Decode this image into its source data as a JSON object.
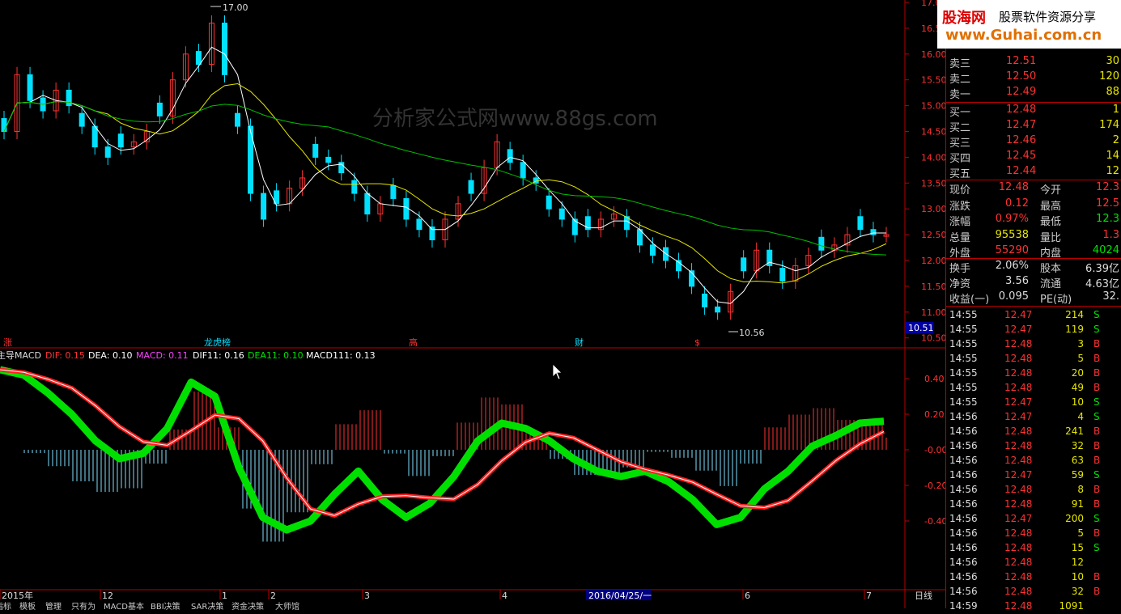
{
  "watermark": "分析家公式网www.88gs.com",
  "logo": {
    "title": "股海网",
    "subtitle": "股票软件资源分享",
    "url": "www.Guhai.com.cn"
  },
  "price_axis": [
    "17.00",
    "16.50",
    "16.00",
    "15.50",
    "15.00",
    "14.50",
    "14.00",
    "13.50",
    "13.00",
    "12.50",
    "12.00",
    "11.50",
    "11.00",
    "10.50"
  ],
  "price_marker": "10.51",
  "high_label": "17.00",
  "low_label": "10.56",
  "events": [
    "涨",
    "龙虎榜",
    "高",
    "财",
    "$"
  ],
  "indicator": {
    "name": "主导MACD",
    "dif_label": "DIF: 0.15",
    "dea_label": "DEA: 0.10",
    "macd_label": "MACD: 0.11",
    "dif11_label": "DIF11: 0.16",
    "dea11_label": "DEA11: 0.10",
    "macd111_label": "MACD111: 0.13",
    "axis": [
      "0.40",
      "0.20",
      "-0.00",
      "-0.20",
      "-0.40"
    ]
  },
  "time_axis": {
    "labels": [
      "2015年",
      "12",
      "1",
      "2",
      "3",
      "4",
      "5",
      "6",
      "7"
    ],
    "cursor": "2016/04/25/一",
    "period": "日线"
  },
  "tabs": [
    "指标",
    "模板",
    "管理",
    "只有为",
    "MACD基本",
    "BBI决策",
    "SAR决策",
    "资金决策",
    "大师馆"
  ],
  "colors": {
    "up": "#ff3232",
    "down": "#00e0ff",
    "ma5": "#ffffff",
    "ma10": "#e6e600",
    "ma30": "#00c000",
    "dif": "#00e000",
    "dea": "#ff2020"
  },
  "order_book": {
    "asks": [
      {
        "label": "卖三",
        "price": "12.51",
        "vol": "30"
      },
      {
        "label": "卖二",
        "price": "12.50",
        "vol": "120"
      },
      {
        "label": "卖一",
        "price": "12.49",
        "vol": "88"
      }
    ],
    "bids": [
      {
        "label": "买一",
        "price": "12.48",
        "vol": "1"
      },
      {
        "label": "买二",
        "price": "12.47",
        "vol": "174"
      },
      {
        "label": "买三",
        "price": "12.46",
        "vol": "2"
      },
      {
        "label": "买四",
        "price": "12.45",
        "vol": "14"
      },
      {
        "label": "买五",
        "price": "12.44",
        "vol": "12"
      }
    ]
  },
  "quote": [
    {
      "l1": "现价",
      "v1": "12.48",
      "l2": "今开",
      "v2": "12.3"
    },
    {
      "l1": "涨跌",
      "v1": "0.12",
      "l2": "最高",
      "v2": "12.5"
    },
    {
      "l1": "涨幅",
      "v1": "0.97%",
      "l2": "最低",
      "v2": "12.3"
    },
    {
      "l1": "总量",
      "v1": "95538",
      "l2": "量比",
      "v2": "1.3"
    },
    {
      "l1": "外盘",
      "v1": "55290",
      "l2": "内盘",
      "v2": "4024"
    }
  ],
  "stats": [
    {
      "l1": "换手",
      "v1": "2.06%",
      "l2": "股本",
      "v2": "6.39亿"
    },
    {
      "l1": "净资",
      "v1": "3.56",
      "l2": "流通",
      "v2": "4.63亿"
    },
    {
      "l1": "收益(一)",
      "v1": "0.095",
      "l2": "PE(动)",
      "v2": "32."
    }
  ],
  "trades": [
    [
      "14:55",
      "12.47",
      "214",
      "S"
    ],
    [
      "14:55",
      "12.47",
      "119",
      "S"
    ],
    [
      "14:55",
      "12.48",
      "3",
      "B"
    ],
    [
      "14:55",
      "12.48",
      "5",
      "B"
    ],
    [
      "14:55",
      "12.48",
      "20",
      "B"
    ],
    [
      "14:55",
      "12.48",
      "49",
      "B"
    ],
    [
      "14:55",
      "12.47",
      "10",
      "S"
    ],
    [
      "14:56",
      "12.47",
      "4",
      "S"
    ],
    [
      "14:56",
      "12.48",
      "241",
      "B"
    ],
    [
      "14:56",
      "12.48",
      "32",
      "B"
    ],
    [
      "14:56",
      "12.48",
      "63",
      "B"
    ],
    [
      "14:56",
      "12.47",
      "59",
      "S"
    ],
    [
      "14:56",
      "12.48",
      "8",
      "B"
    ],
    [
      "14:56",
      "12.48",
      "91",
      "B"
    ],
    [
      "14:56",
      "12.47",
      "200",
      "S"
    ],
    [
      "14:56",
      "12.48",
      "5",
      "B"
    ],
    [
      "14:56",
      "12.48",
      "15",
      "S"
    ],
    [
      "14:56",
      "12.48",
      "12",
      ""
    ],
    [
      "14:56",
      "12.48",
      "10",
      "B"
    ],
    [
      "14:56",
      "12.48",
      "32",
      "B"
    ],
    [
      "14:59",
      "12.48",
      "1091",
      ""
    ]
  ]
}
